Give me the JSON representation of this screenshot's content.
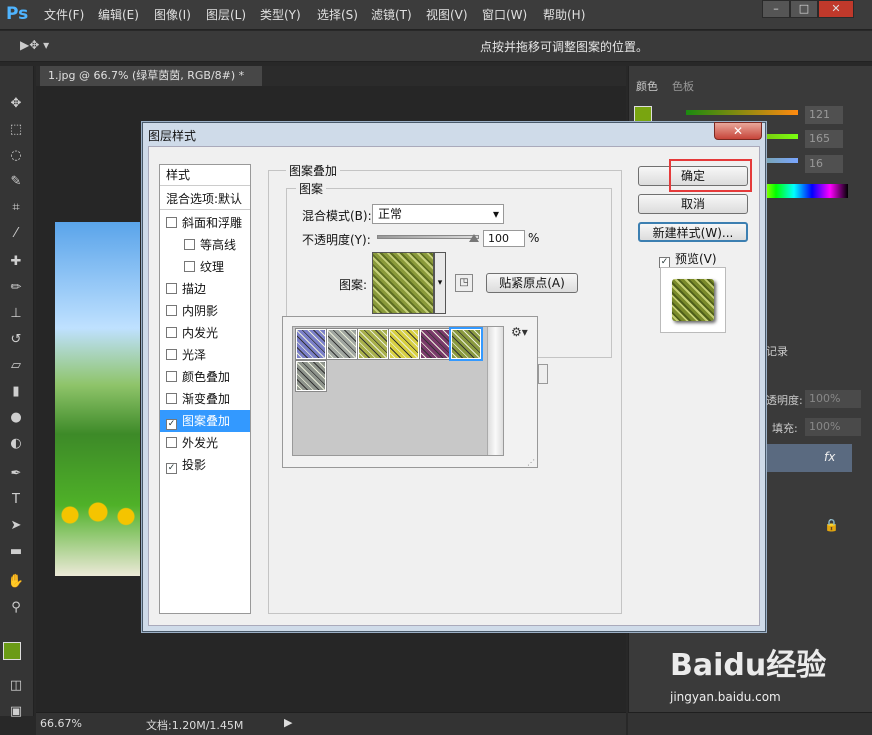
{
  "app": {
    "logo": "Ps"
  },
  "menu": [
    "文件(F)",
    "编辑(E)",
    "图像(I)",
    "图层(L)",
    "类型(Y)",
    "选择(S)",
    "滤镜(T)",
    "视图(V)",
    "窗口(W)",
    "帮助(H)"
  ],
  "options_hint": "点按并拖移可调整图案的位置。",
  "document": {
    "tab": "1.jpg @ 66.7% (绿草茵茵, RGB/8#) *",
    "zoom": "66.67%",
    "docinfo": "文档:1.20M/1.45M"
  },
  "panels": {
    "color_tab": "颜色",
    "swatch_tab": "色板",
    "r": "121",
    "g": "165",
    "b": "16",
    "opacity_label": "透明度:",
    "opacity_val": "100%",
    "fill_label": "填充:",
    "fill_val": "100%",
    "history_label": "记录"
  },
  "dialog": {
    "title": "图层样式",
    "styles_header": "样式",
    "blend_opts": "混合选项:默认",
    "items": [
      {
        "label": "斜面和浮雕",
        "checked": false
      },
      {
        "label": "等高线",
        "checked": false
      },
      {
        "label": "纹理",
        "checked": false
      },
      {
        "label": "描边",
        "checked": false
      },
      {
        "label": "内阴影",
        "checked": false
      },
      {
        "label": "内发光",
        "checked": false
      },
      {
        "label": "光泽",
        "checked": false
      },
      {
        "label": "颜色叠加",
        "checked": false
      },
      {
        "label": "渐变叠加",
        "checked": false
      },
      {
        "label": "图案叠加",
        "checked": true
      },
      {
        "label": "外发光",
        "checked": false
      },
      {
        "label": "投影",
        "checked": true
      }
    ],
    "section_title": "图案叠加",
    "sub_title": "图案",
    "blend_mode_label": "混合模式(B):",
    "blend_mode_value": "正常",
    "opacity_label": "不透明度(Y):",
    "opacity_value": "100",
    "opacity_unit": "%",
    "pattern_label": "图案:",
    "snap_button": "贴紧原点(A)",
    "ok": "确定",
    "cancel": "取消",
    "new_style": "新建样式(W)...",
    "preview_label": "预览(V)",
    "preview_checked": true,
    "swatches": [
      "#7a7fc8",
      "#a0a6a0",
      "#a8b04a",
      "#d8d040",
      "#7a3a6a",
      "#8a9a40",
      "#8e948c"
    ]
  },
  "watermark": {
    "brand": "Baidu经验",
    "url": "jingyan.baidu.com"
  }
}
